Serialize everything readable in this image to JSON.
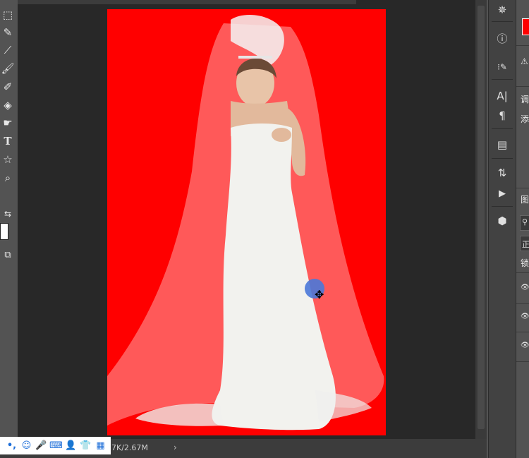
{
  "status_bar": {
    "doc_size": "7K/2.67M",
    "arrow": "›"
  },
  "toolbar": {
    "tools": [
      {
        "name": "marquee-tool-icon",
        "glyph": "⬚"
      },
      {
        "name": "quick-selection-tool-icon",
        "glyph": "✎"
      },
      {
        "name": "eyedropper-tool-icon",
        "glyph": "⟋"
      },
      {
        "name": "brush-tool-icon",
        "glyph": "🖌"
      },
      {
        "name": "history-brush-tool-icon",
        "glyph": "✐"
      },
      {
        "name": "paint-bucket-tool-icon",
        "glyph": "◈"
      },
      {
        "name": "smudge-tool-icon",
        "glyph": "☛"
      },
      {
        "name": "type-tool-icon",
        "glyph": "T"
      },
      {
        "name": "shape-tool-icon",
        "glyph": "☆"
      },
      {
        "name": "zoom-tool-icon",
        "glyph": "⌕"
      }
    ],
    "swap_colors_glyph": "⇆",
    "screen_mode_glyph": "⧉",
    "foreground_color": "#ffffff"
  },
  "panel_icons": [
    {
      "name": "navigator-icon",
      "glyph": "✵"
    },
    {
      "name": "info-icon",
      "glyph": "ⓘ"
    },
    {
      "name": "brush-settings-icon",
      "glyph": "⁝✎"
    },
    {
      "name": "character-icon",
      "glyph": "A|"
    },
    {
      "name": "paragraph-icon",
      "glyph": "¶"
    },
    {
      "name": "notes-icon",
      "glyph": "▤"
    },
    {
      "name": "history-icon",
      "glyph": "⇅"
    },
    {
      "name": "actions-icon",
      "glyph": "▶"
    },
    {
      "name": "3d-icon",
      "glyph": "⬢"
    }
  ],
  "right_panel": {
    "swatch_color": "#ff0000",
    "warning_glyph": "⚠",
    "adjustments_label": "调",
    "add_label": "添",
    "layers_label": "图",
    "search_glyph": "⚲",
    "blend_mode_label": "正",
    "lock_label": "锁",
    "eye_glyph": "👁"
  },
  "ime_bar": {
    "icons": [
      {
        "name": "punctuation-icon",
        "glyph": "•,"
      },
      {
        "name": "emoji-icon",
        "glyph": "☺"
      },
      {
        "name": "microphone-icon",
        "glyph": "🎤"
      },
      {
        "name": "keyboard-icon",
        "glyph": "⌨"
      },
      {
        "name": "user-icon",
        "glyph": "👤"
      },
      {
        "name": "skin-shirt-icon",
        "glyph": "👕"
      },
      {
        "name": "grid-menu-icon",
        "glyph": "▦"
      }
    ]
  },
  "colors": {
    "canvas_background": "#ff0000",
    "workspace": "#282828",
    "ui_gray": "#535353"
  }
}
